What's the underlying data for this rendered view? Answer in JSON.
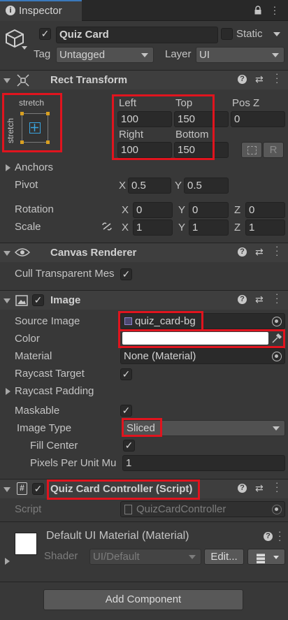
{
  "window": {
    "tab_title": "Inspector"
  },
  "gameobject": {
    "active": true,
    "name": "Quiz Card",
    "static_label": "Static",
    "tag_label": "Tag",
    "tag_value": "Untagged",
    "layer_label": "Layer",
    "layer_value": "UI"
  },
  "rect_transform": {
    "title": "Rect Transform",
    "anchor_h": "stretch",
    "anchor_v": "stretch",
    "left_label": "Left",
    "left_value": "100",
    "top_label": "Top",
    "top_value": "150",
    "posz_label": "Pos Z",
    "posz_value": "0",
    "right_label": "Right",
    "right_value": "100",
    "bottom_label": "Bottom",
    "bottom_value": "150",
    "r_button": "R",
    "anchors_label": "Anchors",
    "pivot_label": "Pivot",
    "pivot_x": "0.5",
    "pivot_y": "0.5",
    "rotation_label": "Rotation",
    "rot_x": "0",
    "rot_y": "0",
    "rot_z": "0",
    "scale_label": "Scale",
    "scale_x": "1",
    "scale_y": "1",
    "scale_z": "1",
    "x": "X",
    "y": "Y",
    "z": "Z"
  },
  "canvas_renderer": {
    "title": "Canvas Renderer",
    "cull_label": "Cull Transparent Mes",
    "cull_checked": true
  },
  "image": {
    "title": "Image",
    "enabled": true,
    "source_image_label": "Source Image",
    "source_image_value": "quiz_card-bg",
    "color_label": "Color",
    "color_value": "#ffffff",
    "material_label": "Material",
    "material_value": "None (Material)",
    "raycast_target_label": "Raycast Target",
    "raycast_target_checked": true,
    "raycast_padding_label": "Raycast Padding",
    "maskable_label": "Maskable",
    "maskable_checked": true,
    "image_type_label": "Image Type",
    "image_type_value": "Sliced",
    "fill_center_label": "Fill Center",
    "fill_center_checked": true,
    "ppu_label": "Pixels Per Unit Mu",
    "ppu_value": "1"
  },
  "script_component": {
    "title": "Quiz Card Controller (Script)",
    "script_label": "Script",
    "script_value": "QuizCardController"
  },
  "material": {
    "title": "Default UI Material (Material)",
    "shader_label": "Shader",
    "shader_value": "UI/Default",
    "edit_button": "Edit..."
  },
  "add_component_button": "Add Component",
  "colors": {
    "background": "#383838",
    "header": "#3e3e3e",
    "field": "#2a2a2a",
    "highlight": "#e0141e"
  },
  "icons": [
    "info-icon",
    "lock-icon",
    "menu-dots-icon",
    "gameobject-cube-icon",
    "rect-transform-icon",
    "help-icon",
    "preset-icon",
    "eye-icon",
    "image-icon",
    "script-icon",
    "scale-link-icon",
    "eyedropper-icon",
    "sprite-icon",
    "script-file-icon",
    "object-picker-icon"
  ]
}
